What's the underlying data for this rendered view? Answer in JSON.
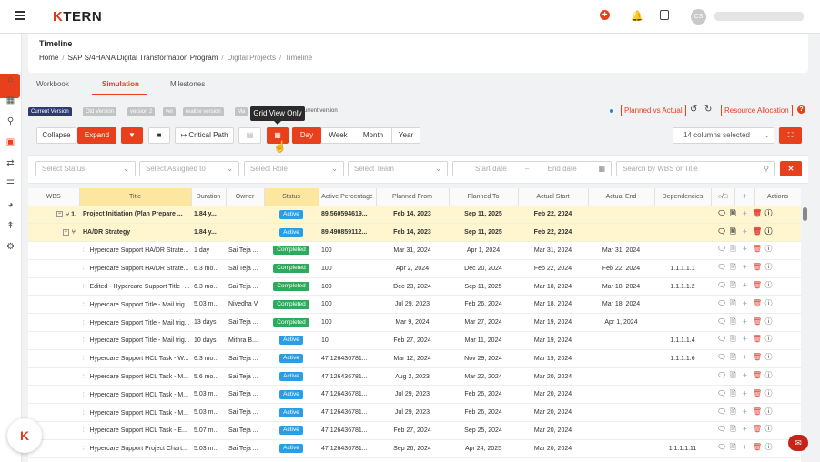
{
  "app": {
    "logo_prefix": "K",
    "logo_suffix": "TERN",
    "avatar_initials": "CS"
  },
  "header": {
    "title": "Timeline",
    "breadcrumb": [
      "Home",
      "SAP S/4HANA Digital Transformation Program",
      "Digital Projects",
      "Timeline"
    ]
  },
  "tabs": [
    "Workbook",
    "Simulation",
    "Milestones"
  ],
  "versions": {
    "chips": [
      "Current Version",
      "Old Version",
      "version 2",
      "ver",
      "realize version",
      "Ma"
    ],
    "trailing_text": "urrent version",
    "tooltip": "Grid View Only"
  },
  "actions": {
    "planned_vs_actual": "Planned vs Actual",
    "resource_allocation": "Resource Allocation"
  },
  "toolbar": {
    "collapse": "Collapse",
    "expand": "Expand",
    "critical_path": "Critical Path",
    "scales": [
      "Day",
      "Week",
      "Month",
      "Year"
    ],
    "columns_selected": "14 columns selected"
  },
  "filters": {
    "status": "Select Status",
    "assigned_to": "Select Assigned to",
    "role": "Select Role",
    "team": "Select Team",
    "start_date": "Start date",
    "end_date": "End date",
    "search": "Search by WBS or Title"
  },
  "grid": {
    "columns": [
      "WBS",
      "Title",
      "Duration",
      "Owner",
      "Status",
      "Active Percentage",
      "Planned From",
      "Planned To",
      "Actual Start",
      "Actual End",
      "Dependencies",
      "",
      "",
      "Actions"
    ],
    "rows": [
      {
        "type": "summary",
        "level": 0,
        "wbs": "1.",
        "title": "Project Initiation (Plan Prepare ...",
        "duration": "1.84 y...",
        "owner": "",
        "status": "Active",
        "pct": "89.560594619...",
        "pfrom": "Feb 14, 2023",
        "pto": "Sep 11, 2025",
        "astart": "Feb 22, 2024",
        "aend": "",
        "deps": ""
      },
      {
        "type": "summary",
        "level": 1,
        "wbs": "",
        "title": "HA/DR Strategy",
        "duration": "1.84 y...",
        "owner": "",
        "status": "Active",
        "pct": "89.490859112...",
        "pfrom": "Feb 14, 2023",
        "pto": "Sep 11, 2025",
        "astart": "Feb 22, 2024",
        "aend": "",
        "deps": ""
      },
      {
        "type": "task",
        "wbs": "",
        "title": "Hypercare Support HA/DR Strate...",
        "duration": "1 day",
        "owner": "Sai Teja ...",
        "status": "Completed",
        "pct": "100",
        "pfrom": "Mar 31, 2024",
        "pto": "Apr 1, 2024",
        "astart": "Mar 31, 2024",
        "aend": "Mar 31, 2024",
        "deps": ""
      },
      {
        "type": "task",
        "wbs": "",
        "title": "Hypercare Support HA/DR Strate...",
        "duration": "6.3 mo...",
        "owner": "Sai Teja ...",
        "status": "Completed",
        "pct": "100",
        "pfrom": "Apr 2, 2024",
        "pto": "Dec 20, 2024",
        "astart": "Feb 22, 2024",
        "aend": "Feb 22, 2024",
        "deps": "1.1.1.1.1"
      },
      {
        "type": "task",
        "wbs": "",
        "title": "Edited - Hypercare Support Title -...",
        "duration": "6.3 mo...",
        "owner": "Sai Teja ...",
        "status": "Completed",
        "pct": "100",
        "pfrom": "Dec 23, 2024",
        "pto": "Sep 11, 2025",
        "astart": "Mar 18, 2024",
        "aend": "Mar 18, 2024",
        "deps": "1.1.1.1.2"
      },
      {
        "type": "task",
        "wbs": "",
        "title": "Hypercare Support Title - Mail trig...",
        "duration": "5.03 m...",
        "owner": "Nivedha V",
        "status": "Completed",
        "pct": "100",
        "pfrom": "Jul 29, 2023",
        "pto": "Feb 26, 2024",
        "astart": "Mar 18, 2024",
        "aend": "Mar 18, 2024",
        "deps": ""
      },
      {
        "type": "task",
        "wbs": "",
        "title": "Hypercare Support Title - Mail trig...",
        "duration": "13 days",
        "owner": "Sai Teja ...",
        "status": "Completed",
        "pct": "100",
        "pfrom": "Mar 9, 2024",
        "pto": "Mar 27, 2024",
        "astart": "Mar 19, 2024",
        "aend": "Apr 1, 2024",
        "deps": ""
      },
      {
        "type": "task",
        "wbs": "",
        "title": "Hypercare Support Title - Mail trig...",
        "duration": "10 days",
        "owner": "Mithra B...",
        "status": "Active",
        "pct": "10",
        "pfrom": "Feb 27, 2024",
        "pto": "Mar 11, 2024",
        "astart": "Mar 19, 2024",
        "aend": "",
        "deps": "1.1.1.1.4"
      },
      {
        "type": "task",
        "wbs": "",
        "title": "Hypercare Support HCL Task - W...",
        "duration": "6.3 mo...",
        "owner": "Sai Teja ...",
        "status": "Active",
        "pct": "47.126436781...",
        "pfrom": "Mar 12, 2024",
        "pto": "Nov 29, 2024",
        "astart": "Mar 19, 2024",
        "aend": "",
        "deps": "1.1.1.1.6"
      },
      {
        "type": "task",
        "wbs": "",
        "title": "Hypercare Support HCL Task - M...",
        "duration": "5.6 mo...",
        "owner": "Sai Teja ...",
        "status": "Active",
        "pct": "47.126436781...",
        "pfrom": "Aug 2, 2023",
        "pto": "Mar 22, 2024",
        "astart": "Mar 20, 2024",
        "aend": "",
        "deps": ""
      },
      {
        "type": "task",
        "wbs": "",
        "title": "Hypercare Support HCL Task - M...",
        "duration": "5.03 m...",
        "owner": "Sai Teja ...",
        "status": "Active",
        "pct": "47.126436781...",
        "pfrom": "Jul 29, 2023",
        "pto": "Feb 26, 2024",
        "astart": "Mar 20, 2024",
        "aend": "",
        "deps": ""
      },
      {
        "type": "task",
        "wbs": "",
        "title": "Hypercare Support HCL Task - M...",
        "duration": "5.03 m...",
        "owner": "Sai Teja ...",
        "status": "Active",
        "pct": "47.126436781...",
        "pfrom": "Jul 29, 2023",
        "pto": "Feb 26, 2024",
        "astart": "Mar 20, 2024",
        "aend": "",
        "deps": ""
      },
      {
        "type": "task",
        "wbs": "",
        "title": "Hypercare Support HCL Task - E...",
        "duration": "5.07 m...",
        "owner": "Sai Teja ...",
        "status": "Active",
        "pct": "47.126436781...",
        "pfrom": "Feb 27, 2024",
        "pto": "Sep 25, 2024",
        "astart": "Mar 20, 2024",
        "aend": "",
        "deps": ""
      },
      {
        "type": "task",
        "wbs": "",
        "title": "Hypercare Support Project Chart...",
        "duration": "5.03 m...",
        "owner": "Sai Teja ...",
        "status": "Active",
        "pct": "47.126436781...",
        "pfrom": "Sep 26, 2024",
        "pto": "Apr 24, 2025",
        "astart": "Mar 20, 2024",
        "aend": "",
        "deps": "1.1.1.1.11"
      }
    ]
  },
  "colors": {
    "accent": "#e8401c",
    "active": "#2a9de3",
    "completed": "#2eaa5c",
    "summary_row": "#fff6cf",
    "highlight_header": "#fde7a0"
  }
}
